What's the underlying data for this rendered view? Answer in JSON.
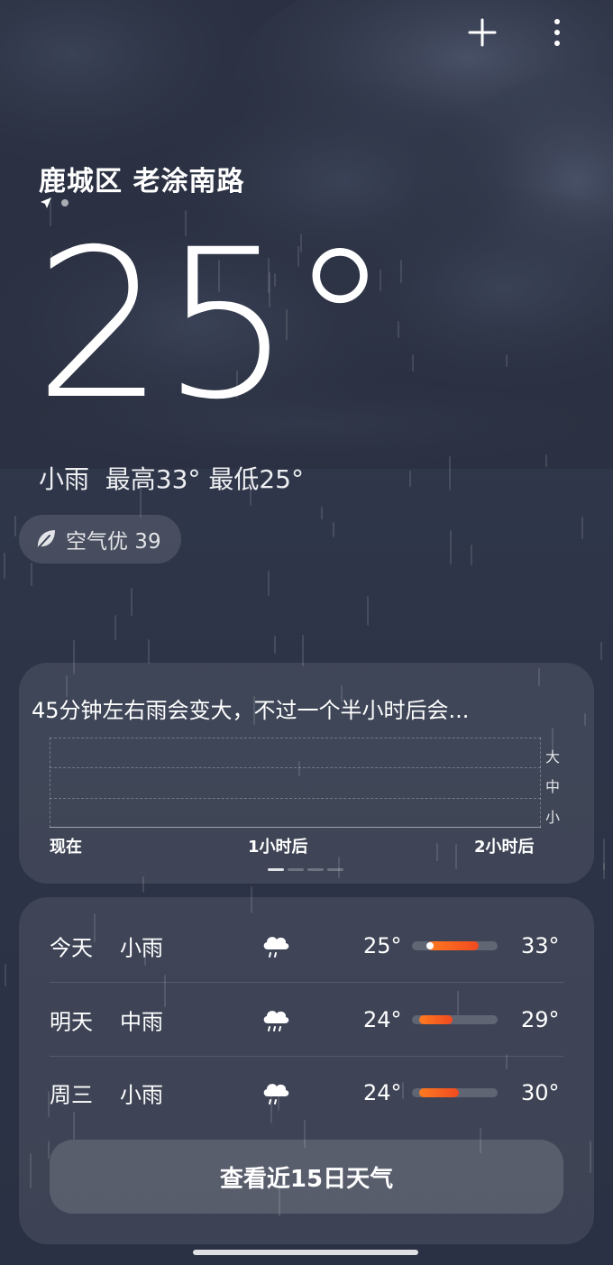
{
  "colors": {
    "accent_bar": "#f04a20",
    "card_bg": "rgba(255,255,255,0.09)"
  },
  "header": {
    "add_icon": "plus-icon",
    "more_icon": "more-vertical-icon"
  },
  "location": {
    "name": "鹿城区 老涂南路",
    "indicator_icon": "location-arrow-icon"
  },
  "current": {
    "temperature": "25°",
    "summary": "小雨  最高33° 最低25°",
    "aqi_label": "空气优 39",
    "aqi_icon": "leaf-icon"
  },
  "precip_card": {
    "text": "45分钟左右雨会变大，不过一个半小时后会...",
    "levels": [
      "大",
      "中",
      "小"
    ],
    "x_labels": [
      "现在",
      "1小时后",
      "2小时后"
    ],
    "pager_count": 4,
    "pager_active": 0
  },
  "daily": [
    {
      "day": "今天",
      "condition": "小雨",
      "icon": "light-rain-icon",
      "low": "25°",
      "high": "33°",
      "range_low": 25,
      "range_high": 33,
      "current": 25
    },
    {
      "day": "明天",
      "condition": "中雨",
      "icon": "moderate-rain-icon",
      "low": "24°",
      "high": "29°",
      "range_low": 24,
      "range_high": 29
    },
    {
      "day": "周三",
      "condition": "小雨",
      "icon": "light-rain-icon",
      "low": "24°",
      "high": "30°",
      "range_low": 24,
      "range_high": 30
    }
  ],
  "fifteen_day_button": "查看近15日天气"
}
